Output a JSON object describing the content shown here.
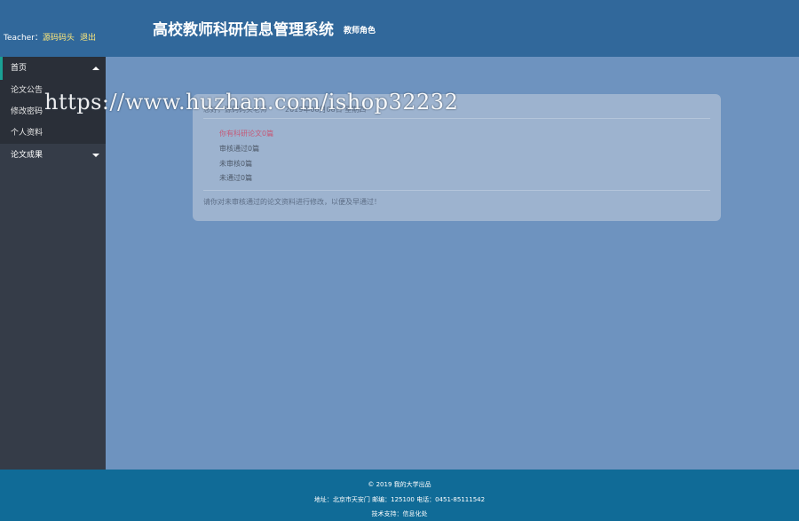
{
  "header": {
    "user_prefix": "Teacher：",
    "user_name": "源码码头",
    "logout": "退出",
    "title": "高校教师科研信息管理系统",
    "role": "教师角色"
  },
  "sidebar": {
    "groups": [
      {
        "label": "首页",
        "items": [
          {
            "label": "论文公告"
          },
          {
            "label": "修改密码"
          },
          {
            "label": "个人资料"
          }
        ]
      },
      {
        "label": "论文成果"
      }
    ]
  },
  "panel": {
    "greeting": "您好，源码码头老师",
    "date": "2019年08月08日 星期四",
    "stats": [
      {
        "text": "你有科研论文0篇"
      },
      {
        "text": "审核通过0篇"
      },
      {
        "text": "未审核0篇"
      },
      {
        "text": "未通过0篇"
      }
    ],
    "notice": "请你对未审核通过的论文资料进行修改，以便及早通过！"
  },
  "footer": {
    "copyright": "© 2019 我的大学出品",
    "address": "地址：北京市天安门 邮编：125100 电话：0451-85111542",
    "support": "技术支持：信息化处"
  },
  "watermark": "https://www.huzhan.com/ishop32232"
}
